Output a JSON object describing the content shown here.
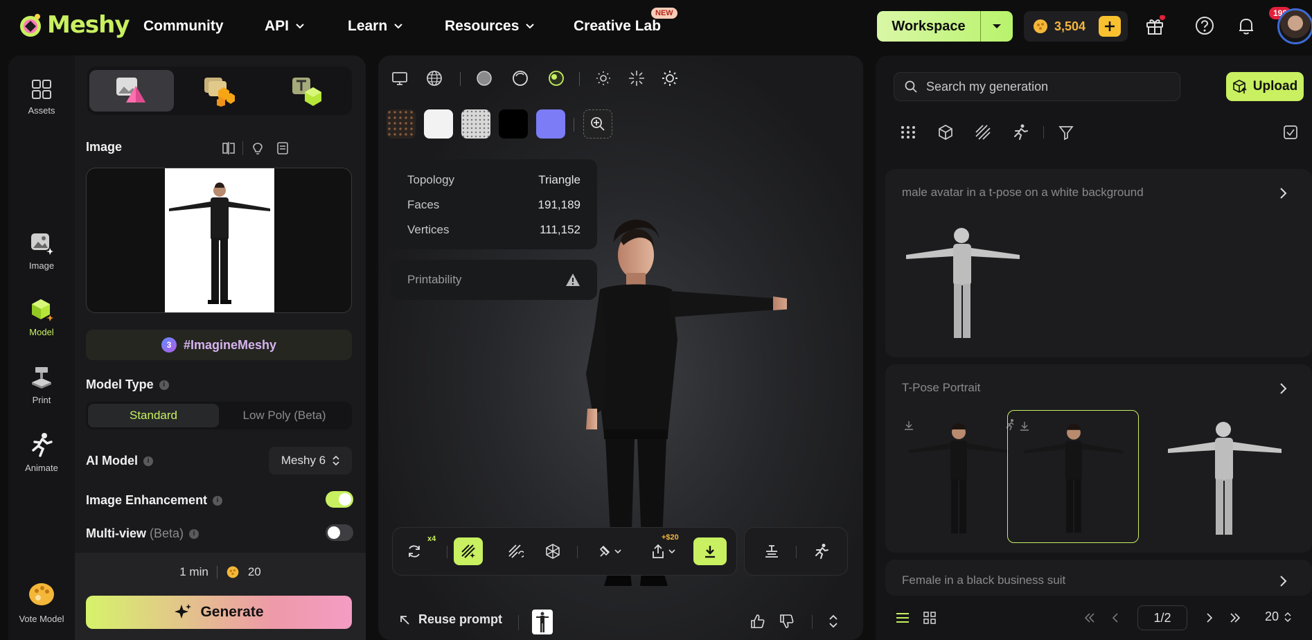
{
  "brand": {
    "name": "Meshy"
  },
  "nav": [
    {
      "label": "Community",
      "dropdown": false
    },
    {
      "label": "API",
      "dropdown": true
    },
    {
      "label": "Learn",
      "dropdown": true
    },
    {
      "label": "Resources",
      "dropdown": true
    },
    {
      "label": "Creative Lab",
      "dropdown": false,
      "badge": "NEW"
    }
  ],
  "topbar": {
    "workspace_label": "Workspace",
    "credits": "3,504",
    "notifications": "198"
  },
  "rail": [
    {
      "label": "Assets",
      "icon": "grid-icon"
    },
    {
      "label": "Image",
      "icon": "image-gen-icon"
    },
    {
      "label": "Model",
      "icon": "model-cube-icon",
      "active": true
    },
    {
      "label": "Print",
      "icon": "printer-icon"
    },
    {
      "label": "Animate",
      "icon": "running-figure-icon"
    },
    {
      "label": "Vote Model",
      "icon": "vote-palette-icon"
    }
  ],
  "left_panel": {
    "image_title": "Image",
    "hashtag": "#ImagineMeshy",
    "hashtag_count": "3",
    "model_type_title": "Model Type",
    "model_types": [
      "Standard",
      "Low Poly (Beta)"
    ],
    "ai_model_title": "AI Model",
    "ai_model_value": "Meshy 6",
    "image_enhancement": "Image Enhancement",
    "image_enhancement_on": true,
    "multiview": "Multi-view",
    "multiview_beta": "(Beta)",
    "multiview_on": false,
    "time": "1 min",
    "cost": "20",
    "generate_label": "Generate"
  },
  "viewer": {
    "stats": [
      {
        "label": "Topology",
        "value": "Triangle"
      },
      {
        "label": "Faces",
        "value": "191,189"
      },
      {
        "label": "Vertices",
        "value": "111,152"
      }
    ],
    "printability": "Printability",
    "retry_multiplier": "x4",
    "export_price": "+$20",
    "reuse_label": "Reuse prompt",
    "swatch_colors": [
      "#2a2420",
      "#f2f2f2",
      "#d8d8d8",
      "#000000",
      "#7b7cf6"
    ]
  },
  "right_panel": {
    "search_placeholder": "Search my generation",
    "upload_label": "Upload",
    "generations": [
      {
        "title": "male avatar in a t-pose on a white background"
      },
      {
        "title": "T-Pose Portrait"
      },
      {
        "title": "Female in a black business suit"
      }
    ],
    "page": "1/2",
    "page_size": "20"
  },
  "colors": {
    "accent": "#c8f060",
    "coin": "#f4b73a",
    "panel": "#1a1a1c"
  }
}
